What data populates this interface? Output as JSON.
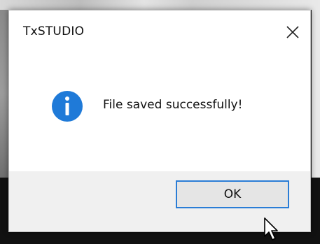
{
  "dialog": {
    "title": "TxSTUDIO",
    "message": "File saved successfully!",
    "ok_label": "OK",
    "close_icon": "close-icon",
    "info_icon": "info-icon"
  },
  "colors": {
    "accent": "#2a7dd6",
    "info_icon_fill": "#1f7ad8",
    "footer_bg": "#f0f0f0"
  }
}
